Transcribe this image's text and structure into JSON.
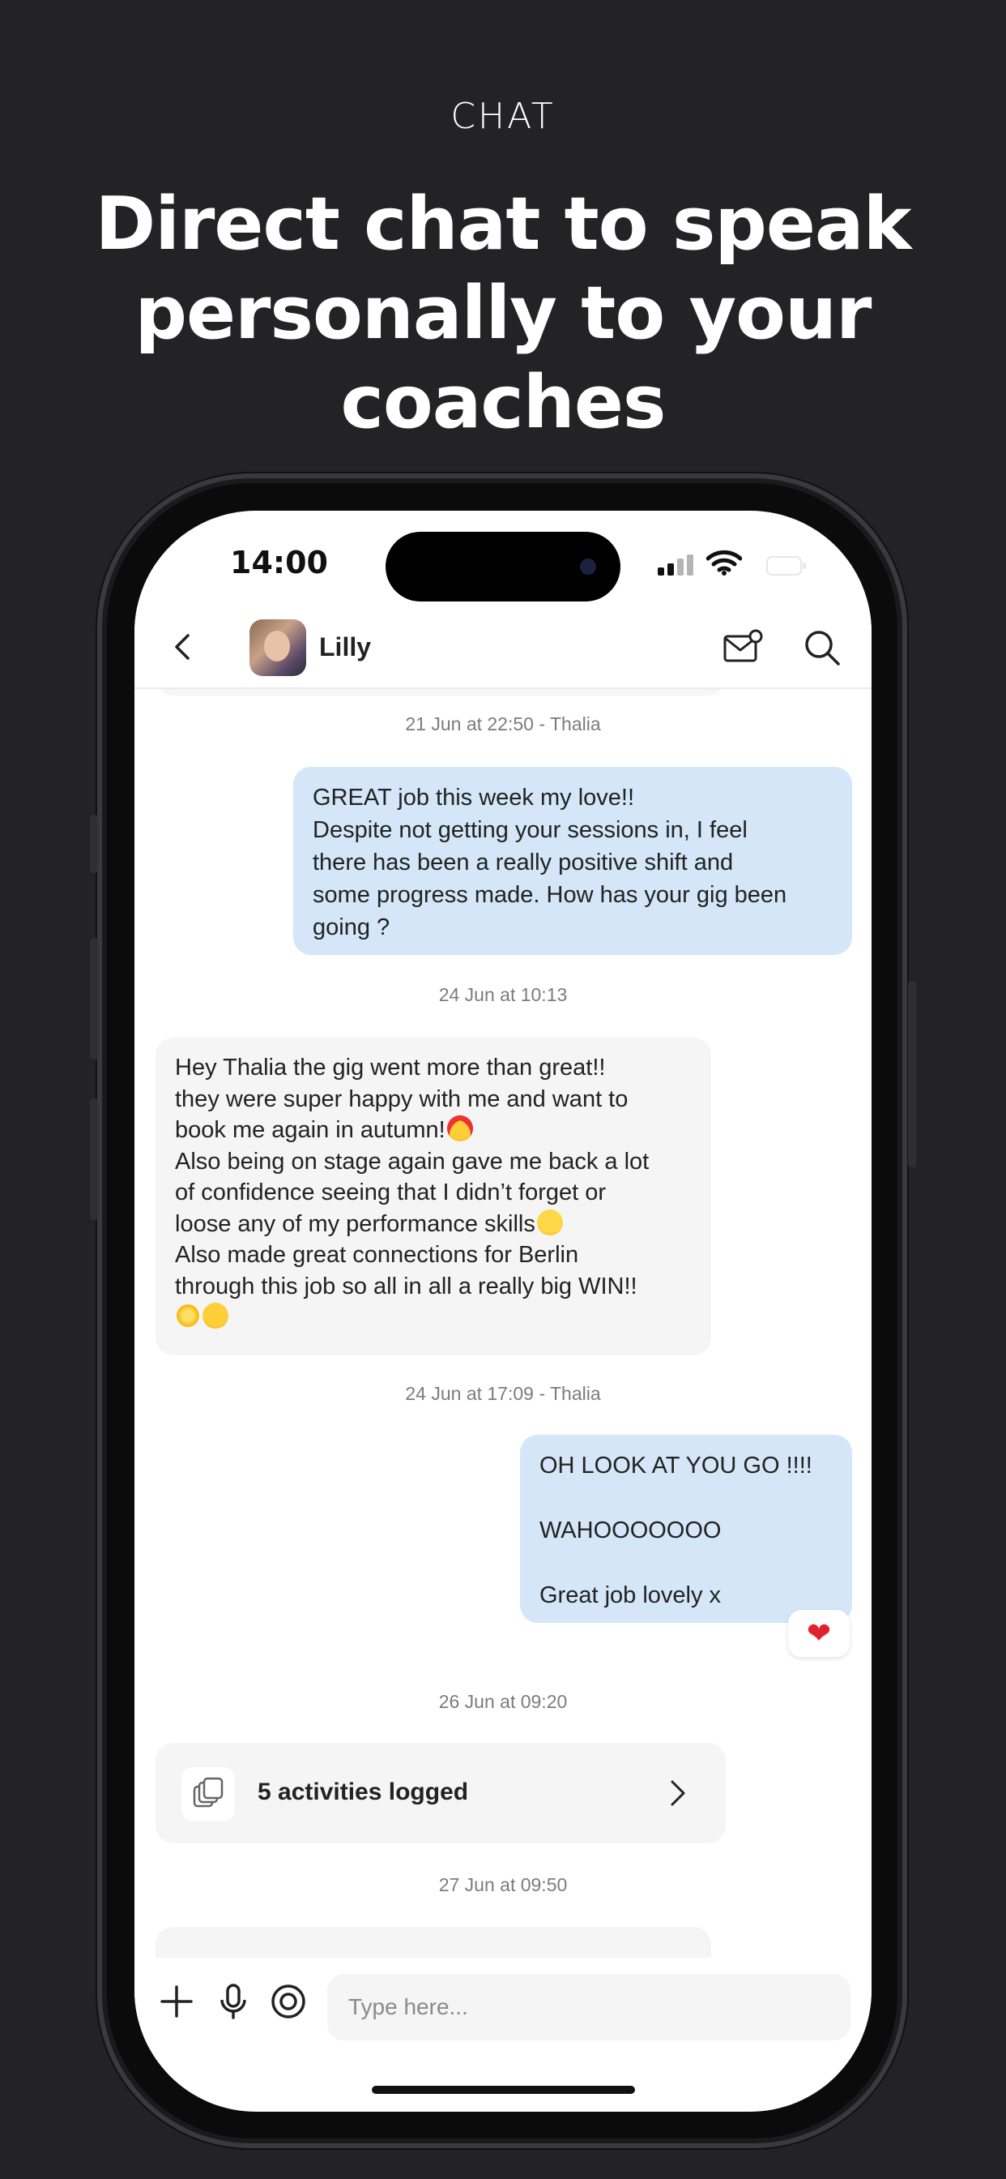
{
  "promo": {
    "eyebrow": "CHAT",
    "headline": "Direct chat to speak personally to your coaches"
  },
  "status_bar": {
    "time": "14:00"
  },
  "header": {
    "contact_name": "Lilly"
  },
  "messages": [
    {
      "timestamp": "21 Jun at 22:50 - Thalia",
      "direction": "out",
      "lines": [
        "GREAT job this week my love!!",
        "Despite not getting your sessions in, I feel",
        "there has been a really positive shift and",
        "some progress made. How has your gig been",
        "going ?"
      ]
    },
    {
      "timestamp": "24 Jun at 10:13",
      "direction": "in",
      "lines": [
        "Hey Thalia the gig went more than great!!",
        "they were super happy with me and want to",
        "book me again in autumn!",
        "Also being on stage again gave me back a lot",
        "of confidence seeing that I didn’t forget or",
        "loose any of my performance skills",
        "Also made great connections for Berlin",
        "through this job so all in all a really big WIN!!"
      ],
      "emojis": [
        "heart-eyes-emoji",
        "relieved-emoji",
        "sparkle-emoji",
        "smiling-hearts-emoji"
      ]
    },
    {
      "timestamp": "24 Jun at 17:09 - Thalia",
      "direction": "out",
      "lines": [
        "OH LOOK AT YOU GO !!!!",
        "WAHOOOOOOO",
        "Great job lovely x"
      ],
      "reaction": "❤"
    }
  ],
  "activity": {
    "timestamp": "26 Jun at 09:20",
    "label": "5 activities logged"
  },
  "next_timestamp": "27 Jun at 09:50",
  "composer": {
    "placeholder": "Type here..."
  },
  "colors": {
    "background": "#232325",
    "outgoing_bubble": "#d4e6f7",
    "incoming_bubble": "#f4f5f4",
    "reaction_heart": "#e0222d"
  },
  "icons": [
    "back-icon",
    "mail-icon",
    "search-icon",
    "copy-stack-icon",
    "chevron-right-icon",
    "plus-icon",
    "microphone-icon",
    "camera-icon"
  ]
}
